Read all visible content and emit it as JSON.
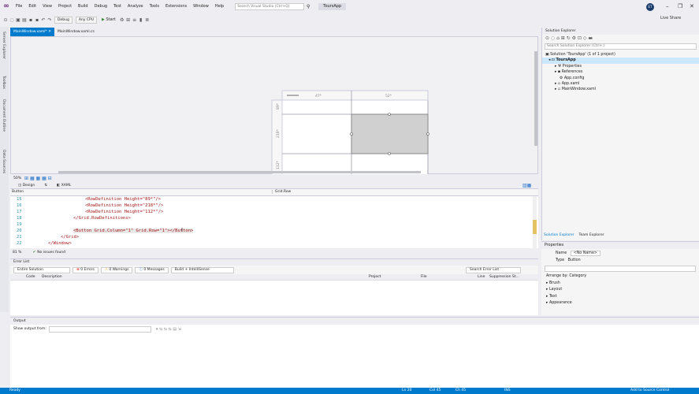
{
  "menu": {
    "items": [
      "File",
      "Edit",
      "View",
      "Project",
      "Build",
      "Debug",
      "Test",
      "Analyze",
      "Tools",
      "Extensions",
      "Window",
      "Help"
    ],
    "search_placeholder": "Search Visual Studio (Ctrl+Q)",
    "project_title": "ToursApp"
  },
  "user": {
    "initials": "ET"
  },
  "toolbar": {
    "config": "Debug",
    "platform": "Any CPU",
    "start_label": "Start"
  },
  "live_share": "Live Share",
  "left_rail": [
    "Server Explorer",
    "Toolbox",
    "Document Outline",
    "Data Sources"
  ],
  "doc_tabs": [
    "MainWindow.xaml*",
    "MainWindow.xaml.cs"
  ],
  "designer": {
    "col_labels": [
      "47*",
      "52*"
    ],
    "row_labels": [
      "89*",
      "218*",
      "112*"
    ]
  },
  "zoom": "50%",
  "view_tabs": {
    "design": "Design",
    "xaml": "XAML"
  },
  "nav": {
    "left": "Button",
    "right": "Grid.Row"
  },
  "code": {
    "lines": [
      {
        "num": "15",
        "text": "<RowDefinition Height=\"89*\"/>"
      },
      {
        "num": "16",
        "text": "<RowDefinition Height=\"218*\"/>"
      },
      {
        "num": "17",
        "text": "<RowDefinition Height=\"112*\"/>"
      },
      {
        "num": "18",
        "text": "</Grid.RowDefinitions>"
      },
      {
        "num": "19",
        "text": ""
      },
      {
        "num": "20",
        "text": "<Button Grid.Column=\"1\" Grid.Row=\"1\"></Button>"
      },
      {
        "num": "21",
        "text": "</Grid>"
      },
      {
        "num": "22",
        "text": "</Window>"
      }
    ]
  },
  "editor_status": {
    "zoom": "81 %",
    "issues": "No issues found"
  },
  "error_list": {
    "title": "Error List",
    "scope": "Entire Solution",
    "errors": "0 Errors",
    "warnings": "0 Warnings",
    "messages": "0 Messages",
    "build": "Build + IntelliSense",
    "search": "Search Error List",
    "columns": [
      "Code",
      "Description",
      "Project",
      "File",
      "Line",
      "Suppression St..."
    ]
  },
  "output": {
    "title": "Output",
    "show_from": "Show output from:"
  },
  "status": {
    "ready": "Ready",
    "ln": "Ln 20",
    "col": "Col 45",
    "ch": "Ch 45",
    "ins": "INS",
    "source_control": "Add to Source Control"
  },
  "solution_explorer": {
    "title": "Solution Explorer",
    "search": "Search Solution Explorer (Ctrl+;)",
    "tree": [
      "Solution 'ToursApp' (1 of 1 project)",
      "ToursApp",
      "Properties",
      "References",
      "App.config",
      "App.xaml",
      "MainWindow.xaml"
    ],
    "tabs": [
      "Solution Explorer",
      "Team Explorer"
    ]
  },
  "properties": {
    "title": "Properties",
    "name_label": "Name",
    "name_value": "<No Name>",
    "type_label": "Type",
    "type_value": "Button",
    "arrange": "Arrange by: Category",
    "categories": [
      "Brush",
      "Layout",
      "Text",
      "Appearance"
    ]
  }
}
